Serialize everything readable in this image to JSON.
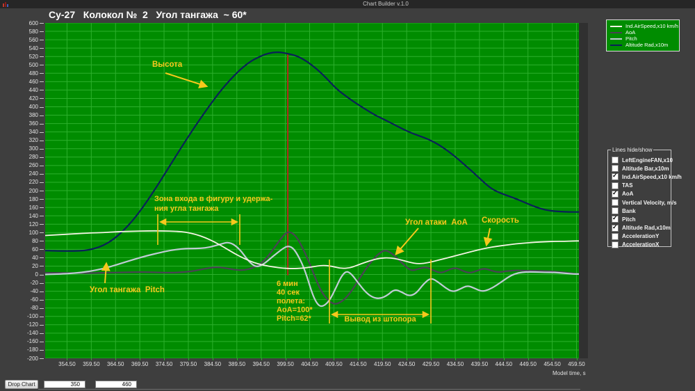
{
  "window": {
    "title": "Chart Builder v.1.0"
  },
  "chart_title": "Су-27   Колокол №  2   Угол тангажа  ~ 60*",
  "legend": {
    "items": [
      {
        "label": "Ind.AirSpeed,x10 km/h",
        "color": "#f4f4e4"
      },
      {
        "label": "AoA",
        "color": "#4a4254"
      },
      {
        "label": "Pitch",
        "color": "#bfccd4"
      },
      {
        "label": "Altitude Rad,x10m",
        "color": "#0a2158"
      }
    ]
  },
  "lines_panel": {
    "title": "Lines hide/show",
    "items": [
      {
        "label": "LeftEngineFAN,x10",
        "checked": false
      },
      {
        "label": "Altitude Bar,x10m",
        "checked": false
      },
      {
        "label": "Ind.AirSpeed,x10 km/h",
        "checked": true
      },
      {
        "label": "TAS",
        "checked": false
      },
      {
        "label": "AoA",
        "checked": true
      },
      {
        "label": "Vertical Velocity, m/s",
        "checked": false
      },
      {
        "label": "Bank",
        "checked": false
      },
      {
        "label": "Pitch",
        "checked": true
      },
      {
        "label": "Altitude Rad,x10m",
        "checked": true
      },
      {
        "label": "AccelerationY",
        "checked": false
      },
      {
        "label": "AccelerationX",
        "checked": false
      }
    ]
  },
  "bottom": {
    "drop_button": "Drop Chart",
    "from_value": "350",
    "to_value": "460"
  },
  "chart_data": {
    "type": "line",
    "title": "Су-27 Колокол № 2 Угол тангажа ~ 60*",
    "x_axis_label": "Model time, s",
    "x_range": [
      350,
      460
    ],
    "y_range": [
      -200,
      600
    ],
    "y_tick_step": 20,
    "grid": true,
    "plot_bg": "#008c00",
    "grid_color": "#2db02d",
    "annotation_color": "#f6c81c",
    "event_line": {
      "t": 400,
      "v_top": 527,
      "v_bottom": -2,
      "color": "#b22a1a"
    },
    "x_tick_labels": [
      "354.50",
      "359.50",
      "364.50",
      "369.50",
      "374.50",
      "379.50",
      "384.50",
      "389.50",
      "394.50",
      "399.50",
      "404.50",
      "409.50",
      "414.50",
      "419.50",
      "424.50",
      "429.50",
      "434.50",
      "439.50",
      "444.50",
      "449.50",
      "454.50",
      "459.50"
    ],
    "y_ticks": [
      600,
      580,
      560,
      540,
      520,
      500,
      480,
      460,
      440,
      420,
      400,
      380,
      360,
      340,
      320,
      300,
      280,
      260,
      240,
      220,
      200,
      180,
      160,
      140,
      120,
      100,
      80,
      60,
      40,
      20,
      0,
      -20,
      -40,
      -60,
      -80,
      -100,
      -120,
      -140,
      -160,
      -180,
      -200
    ],
    "series": [
      {
        "name": "Altitude Rad,x10m",
        "color": "#0a2158",
        "width": 2.2,
        "points": [
          [
            350,
            57
          ],
          [
            353,
            56
          ],
          [
            356,
            56
          ],
          [
            358,
            57
          ],
          [
            360,
            61
          ],
          [
            362,
            69
          ],
          [
            364,
            83
          ],
          [
            366,
            103
          ],
          [
            368,
            128
          ],
          [
            370,
            158
          ],
          [
            372,
            192
          ],
          [
            374,
            228
          ],
          [
            376,
            265
          ],
          [
            378,
            302
          ],
          [
            380,
            338
          ],
          [
            382,
            372
          ],
          [
            384,
            405
          ],
          [
            386,
            436
          ],
          [
            388,
            463
          ],
          [
            390,
            487
          ],
          [
            392,
            506
          ],
          [
            394,
            519
          ],
          [
            396,
            528
          ],
          [
            398,
            531
          ],
          [
            400,
            527
          ],
          [
            402,
            521
          ],
          [
            404,
            508
          ],
          [
            406,
            490
          ],
          [
            408,
            468
          ],
          [
            410,
            443
          ],
          [
            412,
            425
          ],
          [
            414,
            409
          ],
          [
            416,
            394
          ],
          [
            418,
            380
          ],
          [
            420,
            369
          ],
          [
            422,
            357
          ],
          [
            424,
            345
          ],
          [
            426,
            335
          ],
          [
            428,
            327
          ],
          [
            430,
            317
          ],
          [
            432,
            303
          ],
          [
            434,
            286
          ],
          [
            436,
            266
          ],
          [
            438,
            246
          ],
          [
            440,
            224
          ],
          [
            442,
            204
          ],
          [
            444,
            193
          ],
          [
            446,
            185
          ],
          [
            448,
            176
          ],
          [
            450,
            166
          ],
          [
            452,
            157
          ],
          [
            454,
            152
          ],
          [
            456,
            150
          ],
          [
            458,
            149
          ],
          [
            460,
            149
          ]
        ]
      },
      {
        "name": "AoA",
        "color": "#4a4254",
        "width": 2.2,
        "points": [
          [
            350,
            4
          ],
          [
            354,
            4
          ],
          [
            358,
            3
          ],
          [
            362,
            4
          ],
          [
            366,
            5
          ],
          [
            370,
            6
          ],
          [
            373,
            5
          ],
          [
            376,
            4
          ],
          [
            379,
            6
          ],
          [
            381,
            9
          ],
          [
            383,
            14
          ],
          [
            385,
            18
          ],
          [
            387,
            16
          ],
          [
            389,
            11
          ],
          [
            391,
            10
          ],
          [
            393,
            16
          ],
          [
            395,
            30
          ],
          [
            397,
            60
          ],
          [
            399,
            92
          ],
          [
            400,
            102
          ],
          [
            401,
            99
          ],
          [
            402,
            86
          ],
          [
            403,
            65
          ],
          [
            404,
            40
          ],
          [
            405,
            12
          ],
          [
            406,
            -18
          ],
          [
            407,
            -42
          ],
          [
            408,
            -58
          ],
          [
            409,
            -68
          ],
          [
            410,
            -71
          ],
          [
            411.5,
            -62
          ],
          [
            413,
            -42
          ],
          [
            414.5,
            -15
          ],
          [
            416,
            12
          ],
          [
            417.5,
            35
          ],
          [
            419,
            52
          ],
          [
            420,
            58
          ],
          [
            421,
            54
          ],
          [
            422.5,
            40
          ],
          [
            424,
            22
          ],
          [
            425.5,
            8
          ],
          [
            427,
            14
          ],
          [
            428.5,
            18
          ],
          [
            430,
            10
          ],
          [
            431.5,
            3
          ],
          [
            433,
            10
          ],
          [
            434.5,
            17
          ],
          [
            436,
            9
          ],
          [
            437.5,
            3
          ],
          [
            439,
            9
          ],
          [
            440.5,
            15
          ],
          [
            442,
            9
          ],
          [
            443.5,
            5
          ],
          [
            445,
            8
          ],
          [
            447,
            10
          ],
          [
            449,
            9
          ],
          [
            451,
            9
          ],
          [
            453,
            8
          ],
          [
            455,
            7
          ],
          [
            457,
            5
          ],
          [
            459,
            2
          ],
          [
            460,
            1
          ]
        ]
      },
      {
        "name": "Pitch",
        "color": "#bfccd4",
        "width": 2.2,
        "points": [
          [
            350,
            0
          ],
          [
            353,
            1
          ],
          [
            356,
            3
          ],
          [
            359,
            7
          ],
          [
            362,
            14
          ],
          [
            365,
            24
          ],
          [
            368,
            35
          ],
          [
            371,
            45
          ],
          [
            374,
            53
          ],
          [
            376,
            58
          ],
          [
            378,
            61
          ],
          [
            380,
            62
          ],
          [
            382,
            62
          ],
          [
            384,
            65
          ],
          [
            386,
            72
          ],
          [
            388,
            78
          ],
          [
            390,
            62
          ],
          [
            392,
            30
          ],
          [
            393.5,
            17
          ],
          [
            395,
            24
          ],
          [
            397,
            44
          ],
          [
            399,
            62
          ],
          [
            400,
            68
          ],
          [
            401,
            64
          ],
          [
            402,
            48
          ],
          [
            403.5,
            12
          ],
          [
            405,
            -45
          ],
          [
            406,
            -70
          ],
          [
            407,
            -78
          ],
          [
            408.5,
            -65
          ],
          [
            410,
            -30
          ],
          [
            411,
            -5
          ],
          [
            412,
            8
          ],
          [
            413,
            3
          ],
          [
            414.5,
            -20
          ],
          [
            416,
            -42
          ],
          [
            417.5,
            -55
          ],
          [
            419,
            -58
          ],
          [
            420.5,
            -50
          ],
          [
            422,
            -35
          ],
          [
            423.5,
            -42
          ],
          [
            425,
            -52
          ],
          [
            426.5,
            -45
          ],
          [
            428,
            -22
          ],
          [
            429.5,
            -8
          ],
          [
            431,
            -18
          ],
          [
            432.5,
            -32
          ],
          [
            434,
            -42
          ],
          [
            435.5,
            -35
          ],
          [
            437,
            -26
          ],
          [
            438.5,
            -33
          ],
          [
            440,
            -41
          ],
          [
            441.5,
            -36
          ],
          [
            443,
            -26
          ],
          [
            444.5,
            -14
          ],
          [
            446,
            -2
          ],
          [
            447.5,
            4
          ],
          [
            449,
            6
          ],
          [
            451,
            6
          ],
          [
            453,
            5
          ],
          [
            455,
            5
          ],
          [
            457,
            3
          ],
          [
            459,
            1
          ],
          [
            460,
            1
          ]
        ]
      },
      {
        "name": "Ind.AirSpeed,x10 km/h",
        "color": "#f4f4e4",
        "width": 1.8,
        "points": [
          [
            350,
            93
          ],
          [
            353,
            95
          ],
          [
            356,
            97
          ],
          [
            359,
            99
          ],
          [
            362,
            100
          ],
          [
            365,
            102
          ],
          [
            368,
            103
          ],
          [
            371,
            104
          ],
          [
            374,
            104
          ],
          [
            377,
            103
          ],
          [
            379,
            101
          ],
          [
            381,
            96
          ],
          [
            383,
            88
          ],
          [
            385,
            77
          ],
          [
            387,
            64
          ],
          [
            389,
            50
          ],
          [
            391,
            38
          ],
          [
            393,
            28
          ],
          [
            395,
            22
          ],
          [
            397,
            18
          ],
          [
            399,
            15
          ],
          [
            401,
            14
          ],
          [
            403,
            15
          ],
          [
            405,
            18
          ],
          [
            407,
            22
          ],
          [
            409,
            20
          ],
          [
            411,
            14
          ],
          [
            413,
            16
          ],
          [
            415,
            25
          ],
          [
            417,
            33
          ],
          [
            419,
            39
          ],
          [
            421,
            40
          ],
          [
            423,
            36
          ],
          [
            425,
            29
          ],
          [
            427,
            25
          ],
          [
            429,
            28
          ],
          [
            431,
            34
          ],
          [
            433,
            40
          ],
          [
            435,
            46
          ],
          [
            437,
            52
          ],
          [
            439,
            58
          ],
          [
            441,
            63
          ],
          [
            443,
            67
          ],
          [
            445,
            70
          ],
          [
            447,
            73
          ],
          [
            449,
            75
          ],
          [
            451,
            77
          ],
          [
            453,
            78
          ],
          [
            455,
            79
          ],
          [
            457,
            79
          ],
          [
            459,
            80
          ],
          [
            460,
            80
          ]
        ]
      }
    ],
    "annotations": [
      {
        "type": "label",
        "id": "vysota",
        "text": "Высота",
        "tx": 154,
        "ty": 63,
        "arrow": [
          173,
          72,
          232,
          91
        ]
      },
      {
        "type": "span",
        "id": "zona-vhoda",
        "lines": [
          "Зона входа в фигуру и удержа-",
          "ния угла тангажа"
        ],
        "tx": 157,
        "ty": [
          256,
          270
        ],
        "x1": 162,
        "x2": 280,
        "top": 275,
        "bottom": 319,
        "bar": 286,
        "centered": false
      },
      {
        "type": "label",
        "id": "ugol-tangazha",
        "text": "Угол тангажа  Pitch",
        "tx": 64,
        "ty": 387,
        "arrow": [
          86,
          374,
          88,
          346
        ]
      },
      {
        "type": "block",
        "id": "event-info",
        "lines": [
          "6 мин",
          "40 сек",
          "полета:",
          "АоА=100*",
          "Pitch=62*"
        ],
        "tx": 333,
        "ty": 378,
        "lh": 12.5
      },
      {
        "type": "span",
        "id": "vyvod",
        "lines": [
          "Вывод из штопора"
        ],
        "tx": 482,
        "ty": [
          429
        ],
        "x1": 409,
        "x2": 555,
        "top": 340,
        "bottom": 432,
        "bar": 419,
        "centered": true
      },
      {
        "type": "label",
        "id": "ugol-ataki",
        "text": "Угол атаки  АоА",
        "tx": 518,
        "ty": 290,
        "arrow": [
          537,
          295,
          505,
          332
        ]
      },
      {
        "type": "label",
        "id": "skorost",
        "text": "Скорость",
        "tx": 628,
        "ty": 287,
        "arrow": [
          640,
          295,
          635,
          319
        ]
      }
    ]
  }
}
